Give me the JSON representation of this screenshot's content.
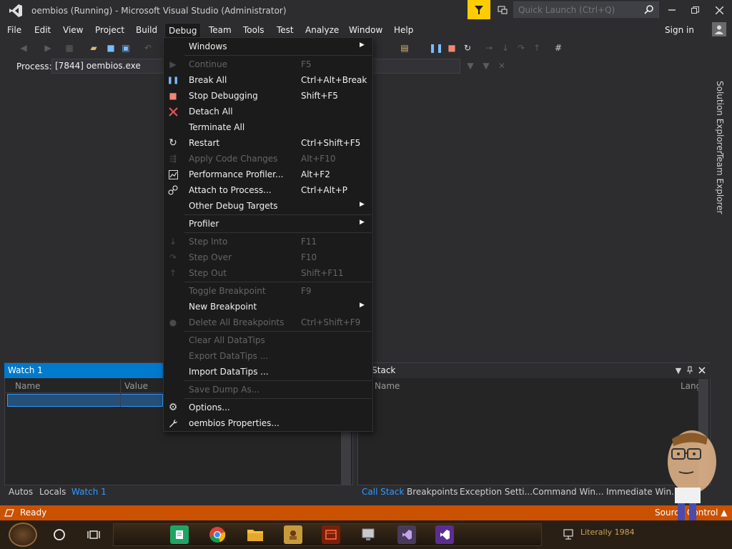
{
  "window": {
    "title": "oembios (Running) - Microsoft Visual Studio  (Administrator)",
    "quick_launch_placeholder": "Quick Launch (Ctrl+Q)"
  },
  "menubar": {
    "items": [
      "File",
      "Edit",
      "View",
      "Project",
      "Build",
      "Debug",
      "Team",
      "Tools",
      "Test",
      "Analyze",
      "Window",
      "Help"
    ],
    "signin": "Sign in"
  },
  "toolbar": {
    "process_label": "Process:",
    "process_value": "[7844] oembios.exe"
  },
  "debug_menu": {
    "items": [
      {
        "label": "Windows",
        "shortcut": "",
        "icon": "",
        "submenu": true,
        "disabled": false
      },
      {
        "label": "Continue",
        "shortcut": "F5",
        "icon": "play-icon",
        "submenu": false,
        "disabled": true
      },
      {
        "label": "Break All",
        "shortcut": "Ctrl+Alt+Break",
        "icon": "pause-icon",
        "submenu": false,
        "disabled": false
      },
      {
        "label": "Stop Debugging",
        "shortcut": "Shift+F5",
        "icon": "stop-icon",
        "submenu": false,
        "disabled": false
      },
      {
        "label": "Detach All",
        "shortcut": "",
        "icon": "x-icon",
        "submenu": false,
        "disabled": false
      },
      {
        "label": "Terminate All",
        "shortcut": "",
        "icon": "",
        "submenu": false,
        "disabled": false
      },
      {
        "label": "Restart",
        "shortcut": "Ctrl+Shift+F5",
        "icon": "restart-icon",
        "submenu": false,
        "disabled": false
      },
      {
        "label": "Apply Code Changes",
        "shortcut": "Alt+F10",
        "icon": "apply-code-icon",
        "submenu": false,
        "disabled": true
      },
      {
        "label": "Performance Profiler...",
        "shortcut": "Alt+F2",
        "icon": "profiler-icon",
        "submenu": false,
        "disabled": false
      },
      {
        "label": "Attach to Process...",
        "shortcut": "Ctrl+Alt+P",
        "icon": "attach-icon",
        "submenu": false,
        "disabled": false
      },
      {
        "label": "Other Debug Targets",
        "shortcut": "",
        "icon": "",
        "submenu": true,
        "disabled": false
      },
      {
        "label": "Profiler",
        "shortcut": "",
        "icon": "",
        "submenu": true,
        "disabled": false
      },
      {
        "label": "Step Into",
        "shortcut": "F11",
        "icon": "step-into-icon",
        "submenu": false,
        "disabled": true
      },
      {
        "label": "Step Over",
        "shortcut": "F10",
        "icon": "step-over-icon",
        "submenu": false,
        "disabled": true
      },
      {
        "label": "Step Out",
        "shortcut": "Shift+F11",
        "icon": "step-out-icon",
        "submenu": false,
        "disabled": true
      },
      {
        "label": "Toggle Breakpoint",
        "shortcut": "F9",
        "icon": "",
        "submenu": false,
        "disabled": true
      },
      {
        "label": "New Breakpoint",
        "shortcut": "",
        "icon": "",
        "submenu": true,
        "disabled": false
      },
      {
        "label": "Delete All Breakpoints",
        "shortcut": "Ctrl+Shift+F9",
        "icon": "delete-breakpoints-icon",
        "submenu": false,
        "disabled": true
      },
      {
        "label": "Clear All DataTips",
        "shortcut": "",
        "icon": "",
        "submenu": false,
        "disabled": true
      },
      {
        "label": "Export DataTips ...",
        "shortcut": "",
        "icon": "",
        "submenu": false,
        "disabled": true
      },
      {
        "label": "Import DataTips ...",
        "shortcut": "",
        "icon": "",
        "submenu": false,
        "disabled": false
      },
      {
        "label": "Save Dump As...",
        "shortcut": "",
        "icon": "",
        "submenu": false,
        "disabled": true
      },
      {
        "label": "Options...",
        "shortcut": "",
        "icon": "gear-icon",
        "submenu": false,
        "disabled": false
      },
      {
        "label": "oembios Properties...",
        "shortcut": "",
        "icon": "wrench-icon",
        "submenu": false,
        "disabled": false
      }
    ]
  },
  "right_strip": {
    "tabs": [
      "Solution Explorer",
      "Team Explorer"
    ]
  },
  "watch_panel": {
    "title": "Watch 1",
    "columns": [
      "Name",
      "Value"
    ],
    "bottom_tabs": [
      "Autos",
      "Locals",
      "Watch 1"
    ]
  },
  "callstack_panel": {
    "title": "l Stack",
    "columns": [
      "Name",
      "Lang"
    ],
    "bottom_tabs": [
      "Call Stack",
      "Breakpoints",
      "Exception Setti...",
      "Command Win...",
      "Immediate Win..."
    ]
  },
  "statusbar": {
    "status": "Ready",
    "source_control": "Source Control"
  },
  "taskbar": {
    "tray_label": "Literally 1984"
  },
  "colors": {
    "accent": "#007acc",
    "status_bar": "#ca5100",
    "menu_bg": "#1b1b1c",
    "feedback_flag": "#ffcc00",
    "break_icon": "#75beff",
    "stop_icon": "#f48771",
    "detach_icon": "#e05555"
  }
}
